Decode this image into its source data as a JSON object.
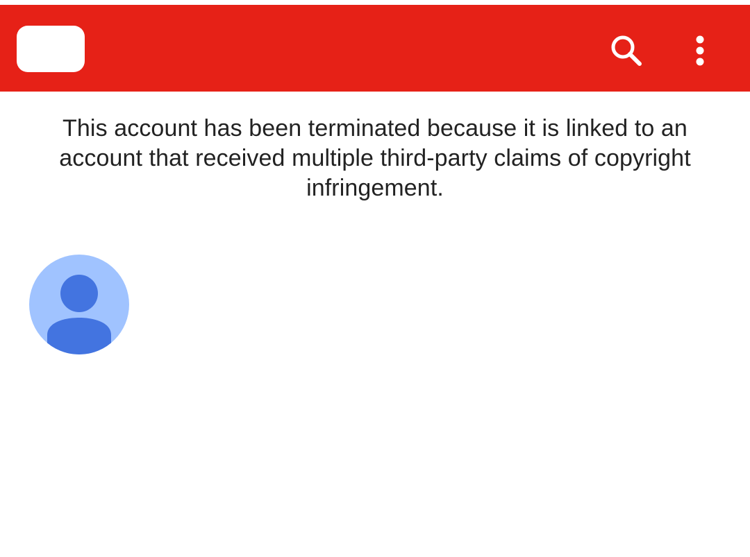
{
  "app_bar": {
    "background_color": "#e62117",
    "logo_icon": "youtube-logo-icon",
    "search_icon": "search-icon",
    "more_icon": "more-vert-icon"
  },
  "main": {
    "termination_message": "This account has been terminated because it is linked to an account that received multiple third-party claims of copyright infringement."
  },
  "channel": {
    "avatar_icon": "default-avatar-icon",
    "avatar_bg_color": "#a0c3ff",
    "avatar_fg_color": "#4374e0"
  }
}
